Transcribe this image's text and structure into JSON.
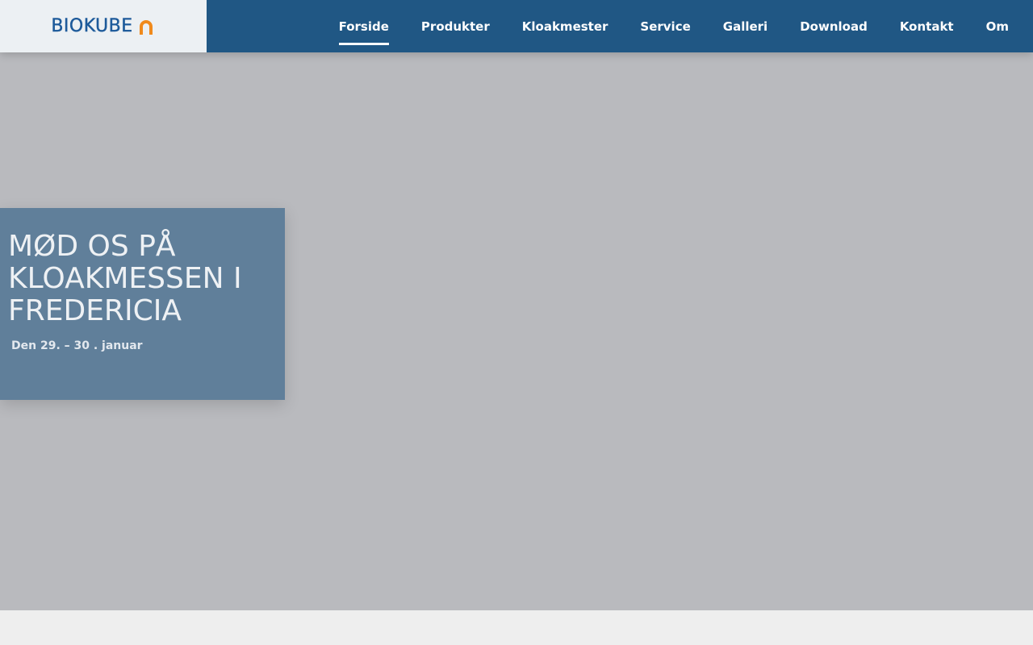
{
  "brand": {
    "name": "BIOKUBE",
    "mark_icon": "horseshoe-arch-icon",
    "colors": {
      "text": "#1d5a9a",
      "mark": "#f08a1c"
    }
  },
  "nav": {
    "items": [
      {
        "label": "Forside",
        "active": true
      },
      {
        "label": "Produkter",
        "active": false
      },
      {
        "label": "Kloakmester",
        "active": false
      },
      {
        "label": "Service",
        "active": false
      },
      {
        "label": "Galleri",
        "active": false
      },
      {
        "label": "Download",
        "active": false
      },
      {
        "label": "Kontakt",
        "active": false
      },
      {
        "label": "Om",
        "active": false
      }
    ]
  },
  "hero": {
    "title": "MØD OS PÅ KLOAKMESSEN I FREDERICIA",
    "subtitle": "Den 29. – 30 . januar"
  },
  "colors": {
    "header_bg": "#205784",
    "logo_bg": "#ecf0f3",
    "hero_bg": "#b9babe",
    "card_bg": "#607f9a"
  }
}
